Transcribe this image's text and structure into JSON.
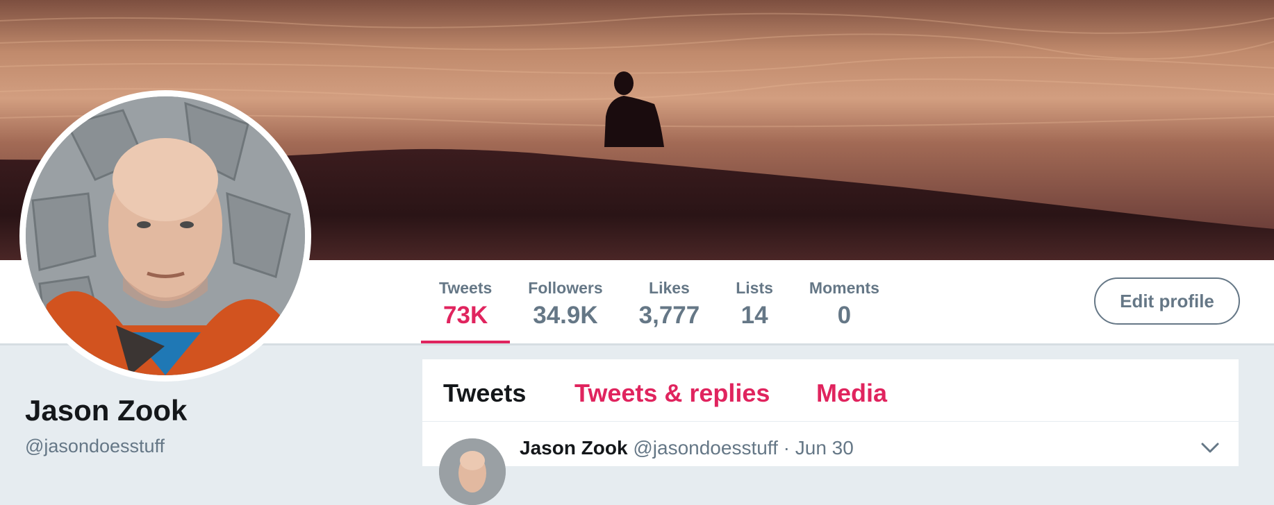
{
  "profile": {
    "name": "Jason Zook",
    "handle": "@jasondoesstuff"
  },
  "stats": [
    {
      "label": "Tweets",
      "value": "73K",
      "active": true
    },
    {
      "label": "Followers",
      "value": "34.9K"
    },
    {
      "label": "Likes",
      "value": "3,777"
    },
    {
      "label": "Lists",
      "value": "14"
    },
    {
      "label": "Moments",
      "value": "0"
    }
  ],
  "edit_profile_label": "Edit profile",
  "timeline": {
    "tabs": [
      "Tweets",
      "Tweets & replies",
      "Media"
    ],
    "tweet": {
      "author": "Jason Zook",
      "handle": "@jasondoesstuff",
      "separator": "·",
      "date": "Jun 30",
      "menu_icon": "chevron-down-icon"
    }
  },
  "colors": {
    "accent": "#e0245e",
    "muted": "#657786",
    "text": "#14171a",
    "background": "#e6ecf0"
  }
}
